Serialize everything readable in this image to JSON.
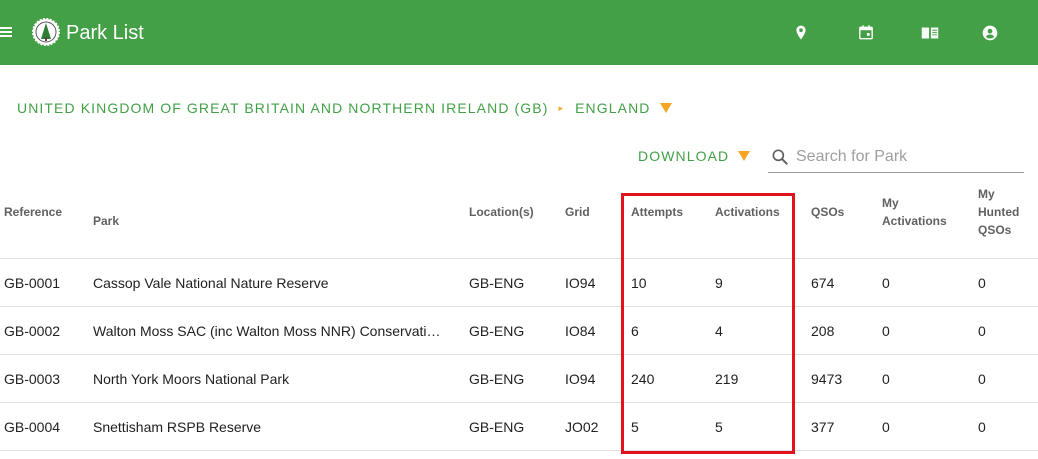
{
  "header": {
    "title": "Park List",
    "background": "#43a047",
    "menu_icon": "hamburger-menu-icon",
    "logo_icon": "park-logo-icon",
    "actions": [
      {
        "icon": "map-marker-icon"
      },
      {
        "icon": "calendar-icon"
      },
      {
        "icon": "book-icon"
      },
      {
        "icon": "account-circle-icon"
      }
    ]
  },
  "breadcrumb": {
    "country": "UNITED KINGDOM OF GREAT BRITAIN AND NORTHERN IRELAND (GB)",
    "separator": "▸",
    "region": "ENGLAND",
    "accent": "#f5a623"
  },
  "toolbar": {
    "download_label": "DOWNLOAD",
    "search_placeholder": "Search for Park",
    "search_value": ""
  },
  "table": {
    "columns": {
      "reference": "Reference",
      "park": "Park",
      "locations": "Location(s)",
      "grid": "Grid",
      "attempts": "Attempts",
      "activations": "Activations",
      "qsos": "QSOs",
      "my_activations_1": "My",
      "my_activations_2": "Activations",
      "my_hunted_1": "My",
      "my_hunted_2": "Hunted",
      "my_hunted_3": "QSOs"
    },
    "rows": [
      {
        "reference": "GB-0001",
        "park": "Cassop Vale National Nature Reserve",
        "locations": "GB-ENG",
        "grid": "IO94",
        "attempts": "10",
        "activations": "9",
        "qsos": "674",
        "my_activations": "0",
        "my_hunted": "0"
      },
      {
        "reference": "GB-0002",
        "park": "Walton Moss SAC (inc Walton Moss NNR) Conservation Area",
        "locations": "GB-ENG",
        "grid": "IO84",
        "attempts": "6",
        "activations": "4",
        "qsos": "208",
        "my_activations": "0",
        "my_hunted": "0"
      },
      {
        "reference": "GB-0003",
        "park": "North York Moors National Park",
        "locations": "GB-ENG",
        "grid": "IO94",
        "attempts": "240",
        "activations": "219",
        "qsos": "9473",
        "my_activations": "0",
        "my_hunted": "0"
      },
      {
        "reference": "GB-0004",
        "park": "Snettisham RSPB Reserve",
        "locations": "GB-ENG",
        "grid": "JO02",
        "attempts": "5",
        "activations": "5",
        "qsos": "377",
        "my_activations": "0",
        "my_hunted": "0"
      }
    ]
  },
  "highlight_color": "#e0141e"
}
